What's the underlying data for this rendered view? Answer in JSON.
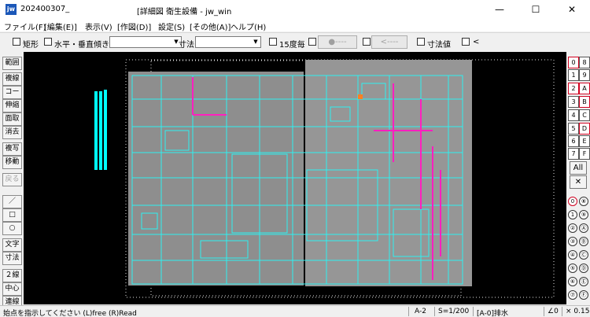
{
  "titlebar": {
    "app_icon": "jw",
    "title_left": "202400307_",
    "title_main": "[詳細図 衛生設備 - jw_win",
    "minimize": "—",
    "maximize": "☐",
    "close": "✕"
  },
  "menu": [
    "ファイル(F)",
    "[編集(E)]",
    "表示(V)",
    "[作図(D)]",
    "設定(S)",
    "[その他(A)]",
    "ヘルプ(H)"
  ],
  "toolbar": {
    "rect": "矩形",
    "horizontal_vertical": "水平・垂直",
    "tilt": "傾き",
    "dimension": "寸法",
    "every15": "15度毎",
    "dot_button": "●----",
    "arrow_button": "<----",
    "dim_value": "寸法値",
    "lt": "<"
  },
  "left_tools": [
    "範囲",
    "複線",
    "コーナー",
    "伸縮",
    "面取",
    "消去",
    "複写",
    "移動",
    "戻る",
    "／",
    "□",
    "○",
    "文字",
    "寸法",
    "２線",
    "中心線",
    "連線"
  ],
  "right_layers_left": [
    "0",
    "1",
    "2",
    "3",
    "4",
    "5",
    "6",
    "7"
  ],
  "right_layers_right": [
    "8",
    "9",
    "A",
    "B",
    "C",
    "D",
    "E",
    "F"
  ],
  "right_all": "All",
  "right_x": "✕",
  "right_groups_left": [
    "0",
    "1",
    "②",
    "③",
    "④",
    "⑤",
    "⑥",
    "⑦"
  ],
  "right_groups_right": [
    "⑧",
    "⑨",
    "Ⓐ",
    "Ⓑ",
    "Ⓒ",
    "Ⓓ",
    "Ⓔ",
    "Ⓕ"
  ],
  "status": {
    "message": "始点を指示してください (L)free (R)Read",
    "layer": "A-2",
    "scale": "S=1/200",
    "layer_name": "[A-0]排水",
    "angle": "∠0",
    "zoom": "× 0.15"
  }
}
